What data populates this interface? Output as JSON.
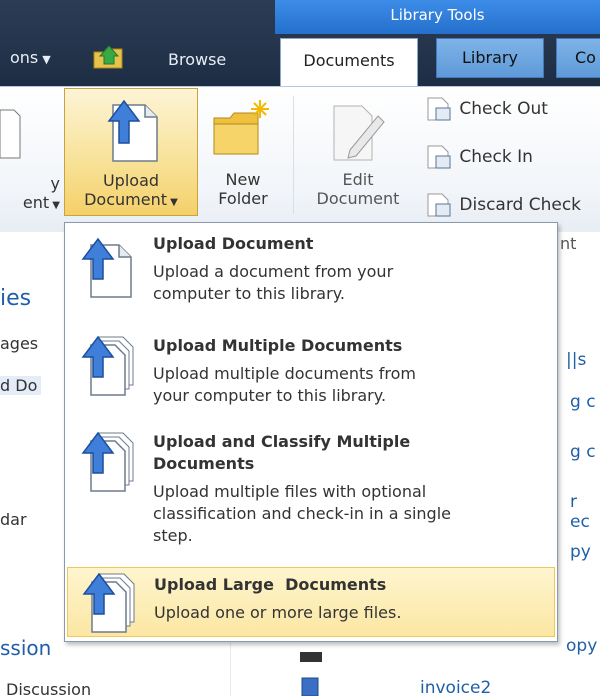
{
  "tabs": {
    "contextual_group": "Library Tools",
    "left_cut": "ons",
    "browse": "Browse",
    "documents": "Documents",
    "library": "Library",
    "co": "Co"
  },
  "ribbon": {
    "cut_button": [
      "y",
      "ent"
    ],
    "upload": [
      "Upload",
      "Document"
    ],
    "new_folder": [
      "New",
      "Folder"
    ],
    "edit_document": [
      "Edit",
      "Document"
    ],
    "check_out": "Check Out",
    "check_in": "Check In",
    "discard": "Discard Check",
    "group_fragment": "nt"
  },
  "left_nav": {
    "heading": "ies",
    "items": [
      "ages",
      "d Do",
      "dar",
      "ssion",
      "Discussion"
    ]
  },
  "main": {
    "fragments": [
      "||s",
      "g c",
      "g c",
      "r ec",
      "py",
      "opy",
      "invoice2"
    ]
  },
  "menu": {
    "items": [
      {
        "title": "Upload Document",
        "desc": [
          "Upload a document from your",
          "computer to this library."
        ]
      },
      {
        "title": "Upload Multiple Documents",
        "desc": [
          "Upload multiple documents from",
          "your computer to this library."
        ]
      },
      {
        "title_lines": [
          "Upload and Classify Multiple",
          "Documents"
        ],
        "desc": [
          "Upload multiple files with optional",
          "classification and check-in in a single",
          "step."
        ]
      },
      {
        "title": "Upload Large  Documents",
        "desc": [
          "Upload one or more large files."
        ]
      }
    ]
  },
  "colors": {
    "top_bar": "#1d2d44",
    "contextual_tab": "#3d8de8",
    "hover_yellow": "#fce7a3",
    "link_blue": "#1f5fa8"
  },
  "icons": {
    "upload": "upload-document-icon",
    "upload_multiple": "upload-multiple-icon",
    "new_folder": "new-folder-icon",
    "edit": "edit-document-icon",
    "check_out": "check-out-icon",
    "check_in": "check-in-icon",
    "discard": "discard-checkout-icon"
  }
}
